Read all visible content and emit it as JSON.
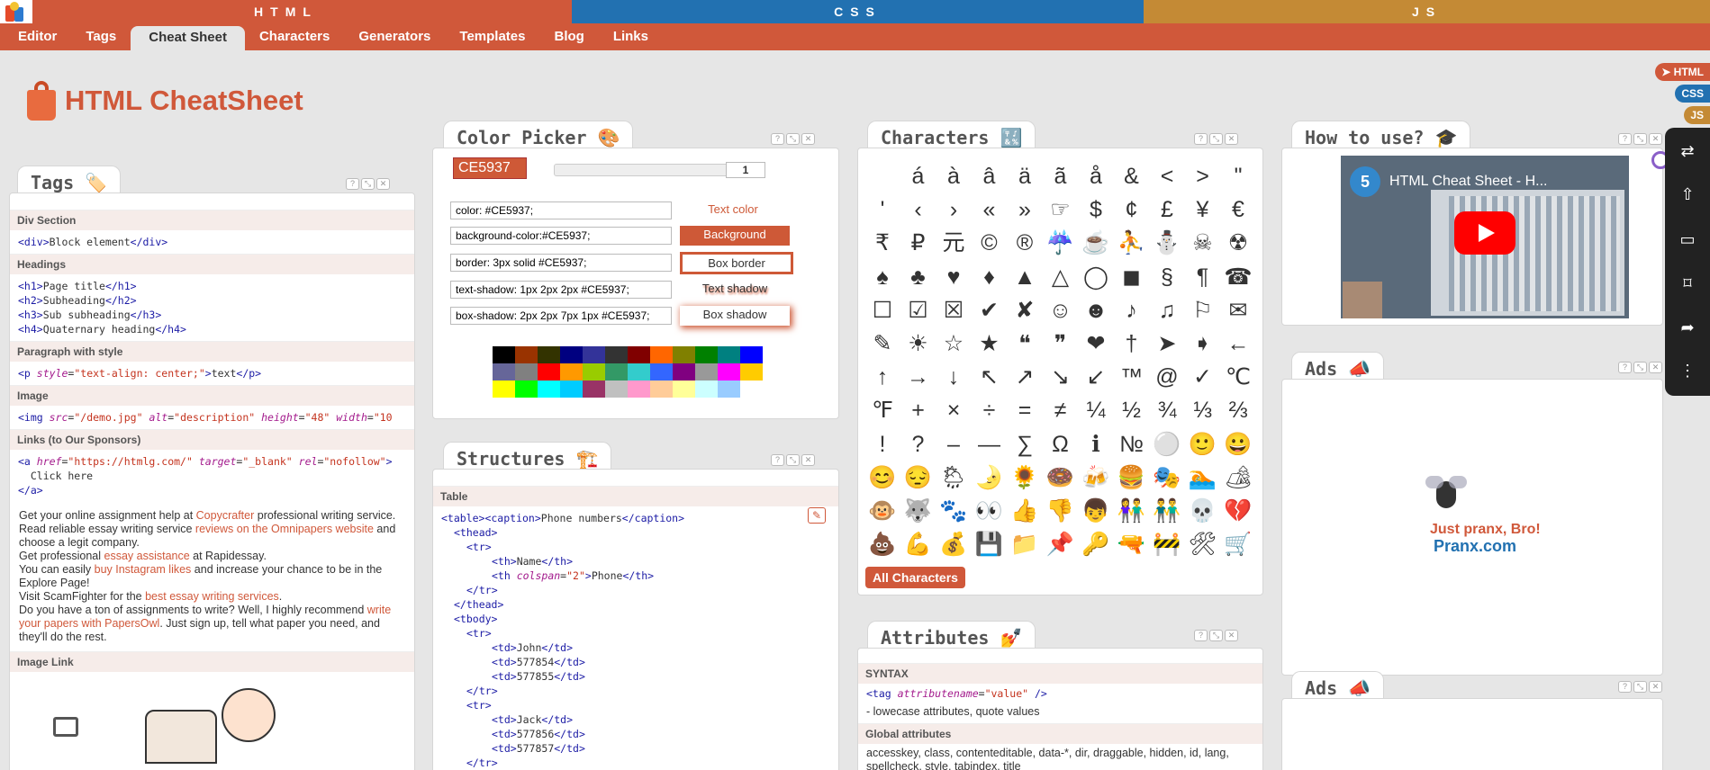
{
  "topbar": {
    "html": "HTML",
    "css": "CSS",
    "js": "JS"
  },
  "nav": [
    "Editor",
    "Tags",
    "Cheat Sheet",
    "Characters",
    "Generators",
    "Templates",
    "Blog",
    "Links"
  ],
  "site_title": "HTML CheatSheet",
  "lang_tags": [
    {
      "label": "➤ HTML",
      "color": "#d0583a"
    },
    {
      "label": "CSS",
      "color": "#2271b1"
    },
    {
      "label": "JS",
      "color": "#c48a35"
    }
  ],
  "tags_panel": {
    "title": "Tags 🏷️",
    "sections": {
      "div": "Div Section",
      "headings": "Headings",
      "para": "Paragraph with style",
      "image": "Image",
      "links": "Links (to Our Sponsors)",
      "image_link": "Image Link"
    },
    "div_code": {
      "open": "<div>",
      "text": "Block element",
      "close": "</div>"
    },
    "headings": [
      {
        "open": "<h1>",
        "text": "Page title",
        "close": "</h1>"
      },
      {
        "open": "<h2>",
        "text": "Subheading",
        "close": "</h2>"
      },
      {
        "open": "<h3>",
        "text": "Sub subheading",
        "close": "</h3>"
      },
      {
        "open": "<h4>",
        "text": "Quaternary heading",
        "close": "</h4>"
      }
    ],
    "para_code": {
      "open": "<p ",
      "attr": "style",
      "val": "\"text-align: center;\"",
      "gt": ">",
      "text": "text",
      "close": "</p>"
    },
    "img_code": {
      "open": "<img ",
      "a1": "src",
      "v1": "\"/demo.jpg\"",
      "a2": "alt",
      "v2": "\"description\"",
      "a3": "height",
      "v3": "\"48\"",
      "a4": "width",
      "v4": "\"10"
    },
    "link_code": {
      "open": "<a ",
      "a1": "href",
      "v1": "\"https://htmlg.com/\"",
      "a2": "target",
      "v2": "\"_blank\"",
      "a3": "rel",
      "v3": "\"nofollow\"",
      "gt": ">",
      "text": "  Click here",
      "close": "</a>"
    },
    "sponsor_text": [
      {
        "pre": "Get your online assignment help at ",
        "link": "Copycrafter",
        "post": " professional writing service."
      },
      {
        "pre": "Read reliable essay writing service ",
        "link": "reviews on the Omnipapers website",
        "post": " and choose a legit company."
      },
      {
        "pre": "Get professional ",
        "link": "essay assistance",
        "post": " at Rapidessay."
      },
      {
        "pre": "You can easily ",
        "link": "buy Instagram likes",
        "post": " and increase your chance to be in the Explore Page!"
      },
      {
        "pre": "Visit ScamFighter for the ",
        "link": "best essay writing services",
        "post": "."
      },
      {
        "pre": "Do you have a ton of assignments to write? Well, I highly recommend ",
        "link": "write your papers with PapersOwl",
        "post": ". Just sign up, tell what paper you need, and they'll do the rest."
      }
    ]
  },
  "color_picker": {
    "title": "Color Picker 🎨",
    "hex": "CE5937",
    "slider_value": "1",
    "rows": [
      {
        "value": "color: #CE5937;",
        "btn": "Text color"
      },
      {
        "value": "background-color:#CE5937;",
        "btn": "Background"
      },
      {
        "value": "border: 3px solid #CE5937;",
        "btn": "Box border"
      },
      {
        "value": "text-shadow: 1px 2px 2px #CE5937;",
        "btn": "Text shadow"
      },
      {
        "value": "box-shadow: 2px 2px 7px 1px #CE5937;",
        "btn": "Box shadow"
      }
    ],
    "palette": [
      [
        "#000000",
        "#993300",
        "#333300",
        "#000080",
        "#333399",
        "#333333",
        "#800000",
        "#ff6600",
        "#808000",
        "#008000",
        "#008080",
        "#0000ff"
      ],
      [
        "#666699",
        "#808080",
        "#ff0000",
        "#ff9900",
        "#99cc00",
        "#339966",
        "#33cccc",
        "#3366ff",
        "#800080",
        "#999999",
        "#ff00ff",
        "#ffcc00"
      ],
      [
        "#ffff00",
        "#00ff00",
        "#00ffff",
        "#00ccff",
        "#993366",
        "#c0c0c0",
        "#ff99cc",
        "#ffcc99",
        "#ffff99",
        "#ccffff",
        "#99ccff"
      ]
    ]
  },
  "structures": {
    "title": "Structures 🏗️",
    "section": "Table",
    "lines": [
      {
        "indent": 0,
        "parts": [
          [
            "tg",
            "<table><caption>"
          ],
          [
            "tx",
            "Phone numbers"
          ],
          [
            "tg",
            "</caption>"
          ]
        ]
      },
      {
        "indent": 1,
        "parts": [
          [
            "tg",
            "<thead>"
          ]
        ]
      },
      {
        "indent": 2,
        "parts": [
          [
            "tg",
            "<tr>"
          ]
        ]
      },
      {
        "indent": 4,
        "parts": [
          [
            "tg",
            "<th>"
          ],
          [
            "tx",
            "Name"
          ],
          [
            "tg",
            "</th>"
          ]
        ]
      },
      {
        "indent": 4,
        "parts": [
          [
            "tg",
            "<th "
          ],
          [
            "at",
            "colspan"
          ],
          [
            "tx",
            "="
          ],
          [
            "st",
            "\"2\""
          ],
          [
            "tg",
            ">"
          ],
          [
            "tx",
            "Phone"
          ],
          [
            "tg",
            "</th>"
          ]
        ]
      },
      {
        "indent": 2,
        "parts": [
          [
            "tg",
            "</tr>"
          ]
        ]
      },
      {
        "indent": 1,
        "parts": [
          [
            "tg",
            "</thead>"
          ]
        ]
      },
      {
        "indent": 1,
        "parts": [
          [
            "tg",
            "<tbody>"
          ]
        ]
      },
      {
        "indent": 2,
        "parts": [
          [
            "tg",
            "<tr>"
          ]
        ]
      },
      {
        "indent": 4,
        "parts": [
          [
            "tg",
            "<td>"
          ],
          [
            "tx",
            "John"
          ],
          [
            "tg",
            "</td>"
          ]
        ]
      },
      {
        "indent": 4,
        "parts": [
          [
            "tg",
            "<td>"
          ],
          [
            "tx",
            "577854"
          ],
          [
            "tg",
            "</td>"
          ]
        ]
      },
      {
        "indent": 4,
        "parts": [
          [
            "tg",
            "<td>"
          ],
          [
            "tx",
            "577855"
          ],
          [
            "tg",
            "</td>"
          ]
        ]
      },
      {
        "indent": 2,
        "parts": [
          [
            "tg",
            "</tr>"
          ]
        ]
      },
      {
        "indent": 2,
        "parts": [
          [
            "tg",
            "<tr>"
          ]
        ]
      },
      {
        "indent": 4,
        "parts": [
          [
            "tg",
            "<td>"
          ],
          [
            "tx",
            "Jack"
          ],
          [
            "tg",
            "</td>"
          ]
        ]
      },
      {
        "indent": 4,
        "parts": [
          [
            "tg",
            "<td>"
          ],
          [
            "tx",
            "577856"
          ],
          [
            "tg",
            "</td>"
          ]
        ]
      },
      {
        "indent": 4,
        "parts": [
          [
            "tg",
            "<td>"
          ],
          [
            "tx",
            "577857"
          ],
          [
            "tg",
            "</td>"
          ]
        ]
      },
      {
        "indent": 2,
        "parts": [
          [
            "tg",
            "</tr>"
          ]
        ]
      }
    ]
  },
  "characters": {
    "title": "Characters 🔣",
    "rows": [
      [
        " ",
        "á",
        "à",
        "â",
        "ä",
        "ã",
        "å",
        "&",
        "<",
        ">",
        "\""
      ],
      [
        "'",
        "‹",
        "›",
        "«",
        "»",
        "☞",
        "$",
        "¢",
        "£",
        "¥",
        "€"
      ],
      [
        "₹",
        "₽",
        "元",
        "©",
        "®",
        "☔",
        "☕",
        "⛹",
        "⛄",
        "☠",
        "☢"
      ],
      [
        "♠",
        "♣",
        "♥",
        "♦",
        "▲",
        "△",
        "◯",
        "◼",
        "§",
        "¶",
        "☎"
      ],
      [
        "☐",
        "☑",
        "☒",
        "✔",
        "✘",
        "☺",
        "☻",
        "♪",
        "♫",
        "⚐",
        "✉"
      ],
      [
        "✎",
        "☀",
        "☆",
        "★",
        "❝",
        "❞",
        "❤",
        "†",
        "➤",
        "➧",
        "←"
      ],
      [
        "↑",
        "→",
        "↓",
        "↖",
        "↗",
        "↘",
        "↙",
        "™",
        "@",
        "✓",
        "℃"
      ],
      [
        "℉",
        "+",
        "×",
        "÷",
        "=",
        "≠",
        "¼",
        "½",
        "¾",
        "⅓",
        "⅔"
      ],
      [
        "!",
        "?",
        "–",
        "—",
        "∑",
        "Ω",
        "ℹ",
        "№",
        "⚪",
        "🙂",
        "😀"
      ],
      [
        "😊",
        "😔",
        "🌦",
        "🌛",
        "🌻",
        "🍩",
        "🍻",
        "🍔",
        "🎭",
        "🏊",
        "🏕"
      ],
      [
        "🐵",
        "🐺",
        "🐾",
        "👀",
        "👍",
        "👎",
        "👦",
        "👫",
        "👬",
        "💀",
        "💔"
      ],
      [
        "💩",
        "💪",
        "💰",
        "💾",
        "📁",
        "📌",
        "🔑",
        "🔫",
        "🚧",
        "🛠",
        "🛒"
      ]
    ],
    "all_button": "All Characters"
  },
  "attributes": {
    "title": "Attributes 💅",
    "syntax_label": "SYNTAX",
    "syntax": {
      "open": "<tag ",
      "attr": "attributename",
      "eq": "=",
      "val": "\"value\"",
      "close": " />"
    },
    "syntax_note": "- lowecase attributes, quote values",
    "global_label": "Global attributes",
    "global_list": "accesskey, class, contenteditable, data-*, dir, draggable, hidden, id, lang, spellcheck, style, tabindex, title"
  },
  "how_to": {
    "title": "How to use? 🎓",
    "video_title": "HTML Cheat Sheet - H..."
  },
  "ads1": {
    "title": "Ads 📣",
    "line1": "Just pranx, Bro!",
    "line2": "Pranx.com"
  },
  "ads2": {
    "title": "Ads 📣"
  }
}
